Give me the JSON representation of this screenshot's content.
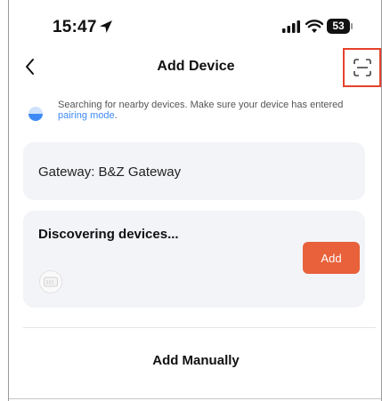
{
  "status_bar": {
    "time": "15:47",
    "battery": "53",
    "icons": [
      "location-arrow-icon",
      "cellular-signal-icon",
      "wifi-icon",
      "battery-icon"
    ]
  },
  "nav": {
    "title": "Add Device",
    "back_icon": "chevron-left-icon",
    "scan_icon": "scan-frame-icon",
    "highlight_color": "#e5422b"
  },
  "notice": {
    "text": "Searching for nearby devices. Make sure your device has entered ",
    "link_text": "pairing mode",
    "suffix": ".",
    "link_color": "#3d8af7"
  },
  "gateway": {
    "label": "Gateway: B&Z Gateway"
  },
  "discovery": {
    "title": "Discovering devices...",
    "add_button_label": "Add",
    "button_color": "#e8613a",
    "device_icon": "device-thumbnail-icon"
  },
  "footer": {
    "add_manually_label": "Add Manually"
  }
}
